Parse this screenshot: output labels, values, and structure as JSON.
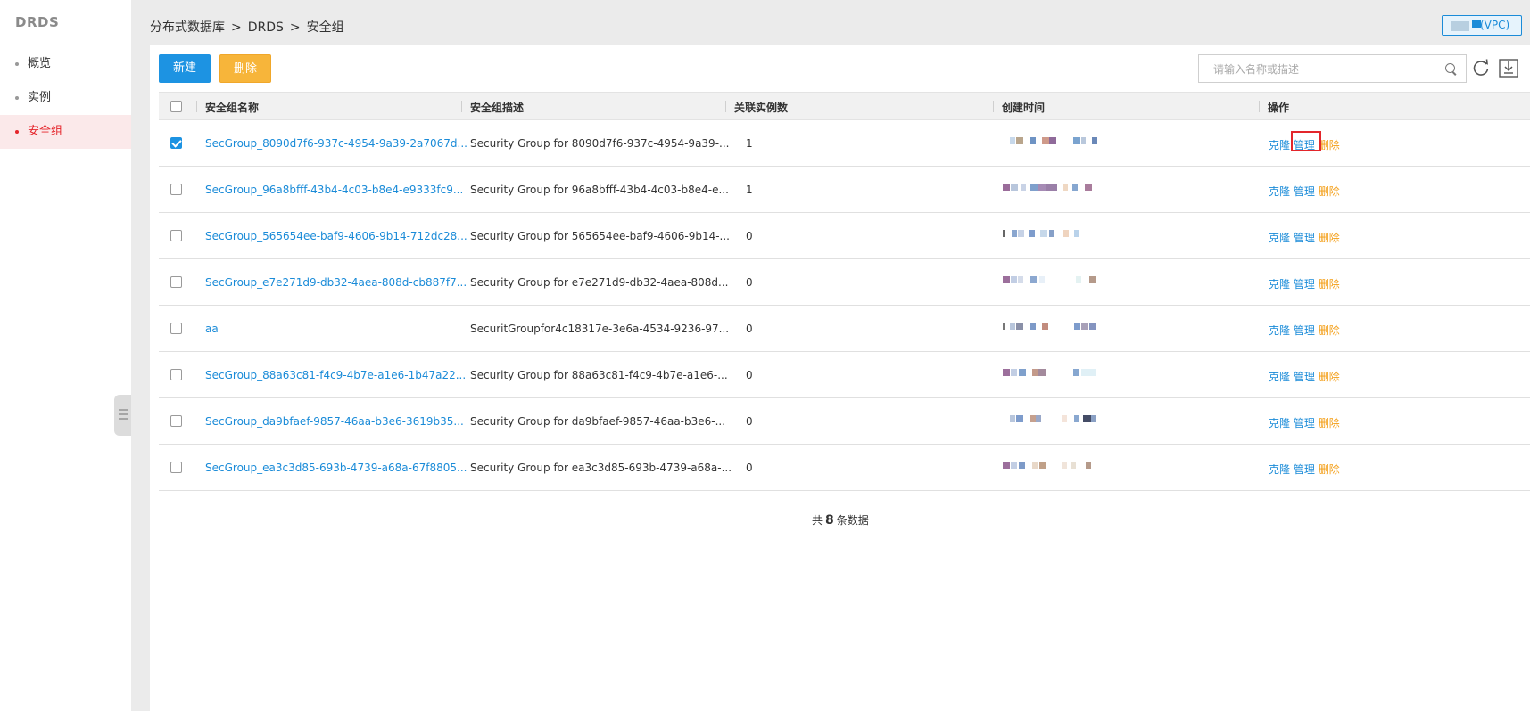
{
  "sidebar": {
    "title": "DRDS",
    "items": [
      {
        "label": "概览"
      },
      {
        "label": "实例"
      },
      {
        "label": "安全组"
      }
    ]
  },
  "header": {
    "breadcrumb": [
      "分布式数据库",
      "DRDS",
      "安全组"
    ],
    "breadcrumb_sep": ">",
    "region_label": "(VPC)"
  },
  "toolbar": {
    "new_label": "新建",
    "delete_label": "删除",
    "search_placeholder": "请输入名称或描述"
  },
  "table": {
    "columns": [
      "安全组名称",
      "安全组描述",
      "关联实例数",
      "创建时间",
      "操作"
    ],
    "rows": [
      {
        "checked": true,
        "name": "SecGroup_8090d7f6-937c-4954-9a39-2a7067d...",
        "desc": "Security Group for 8090d7f6-937c-4954-9a39-...",
        "count": "1"
      },
      {
        "checked": false,
        "name": "SecGroup_96a8bfff-43b4-4c03-b8e4-e9333fc9...",
        "desc": "Security Group for 96a8bfff-43b4-4c03-b8e4-e...",
        "count": "1"
      },
      {
        "checked": false,
        "name": "SecGroup_565654ee-baf9-4606-9b14-712dc28...",
        "desc": "Security Group for 565654ee-baf9-4606-9b14-...",
        "count": "0"
      },
      {
        "checked": false,
        "name": "SecGroup_e7e271d9-db32-4aea-808d-cb887f7...",
        "desc": "Security Group for e7e271d9-db32-4aea-808d...",
        "count": "0"
      },
      {
        "checked": false,
        "name": "aa",
        "desc": "SecuritGroupfor4c18317e-3e6a-4534-9236-97...",
        "count": "0"
      },
      {
        "checked": false,
        "name": "SecGroup_88a63c81-f4c9-4b7e-a1e6-1b47a22...",
        "desc": "Security Group for 88a63c81-f4c9-4b7e-a1e6-...",
        "count": "0"
      },
      {
        "checked": false,
        "name": "SecGroup_da9bfaef-9857-46aa-b3e6-3619b35...",
        "desc": "Security Group for da9bfaef-9857-46aa-b3e6-...",
        "count": "0"
      },
      {
        "checked": false,
        "name": "SecGroup_ea3c3d85-693b-4739-a68a-67f8805...",
        "desc": "Security Group for ea3c3d85-693b-4739-a68a-...",
        "count": "0"
      }
    ],
    "actions": {
      "clone": "克隆",
      "manage": "管理",
      "delete": "删除"
    }
  },
  "footer": {
    "prefix": "共",
    "total": "8",
    "suffix": "条数据"
  },
  "colors": {
    "accent": "#1a8bd8",
    "warning": "#f7b53a",
    "active": "#e5252b",
    "highlight_box": "#e3262b"
  }
}
